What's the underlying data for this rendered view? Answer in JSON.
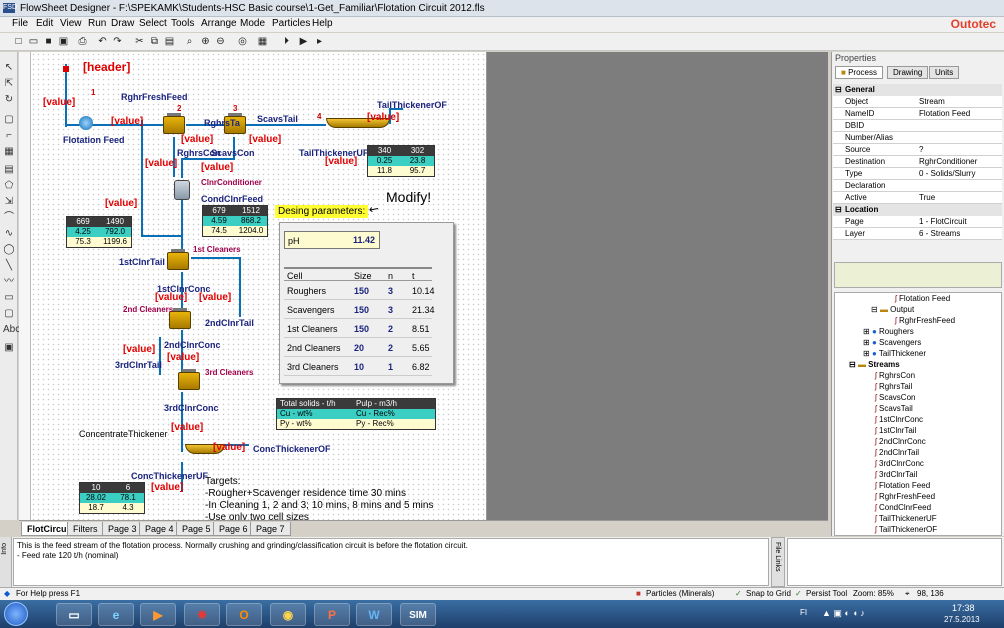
{
  "window": {
    "title": "FlowSheet Designer - F:\\SPEKAMK\\Students-HSC Basic course\\1-Get_Familiar\\Flotation Circuit 2012.fls",
    "brand": "Outotec"
  },
  "menu": [
    "File",
    "Edit",
    "View",
    "Run",
    "Draw",
    "Select",
    "Tools",
    "Arrange",
    "Mode",
    "Particles",
    "Help"
  ],
  "canvas": {
    "header": "[header]",
    "value": "[value]",
    "numbers": [
      "1",
      "2",
      "3",
      "4"
    ],
    "streams": {
      "rghr_fresh_feed": "RghrFreshFeed",
      "flotation_feed": "Flotation Feed",
      "rghrs_ta": "RghrsTa",
      "scavs_tail": "ScavsTail",
      "tail_thickener_of": "TailThickenerOF",
      "rghrs_con": "RghrsCon",
      "scavs_con": "ScavsCon",
      "tail_thickener_uf": "TailThickenerUF",
      "cond_clnr_feed": "CondClnrFeed",
      "first_clnr_tail": "1stClnrTail",
      "first_clnr_conc": "1stClnrConc",
      "second_clnr_tail": "2ndClnrTail",
      "second_clnr_conc": "2ndClnrConc",
      "third_clnr_tail": "3rdClnrTail",
      "third_clnr_conc": "3rdClnrConc",
      "conc_thickener_of": "ConcThickenerOF",
      "conc_thickener_uf": "ConcThickenerUF"
    },
    "processes": {
      "clnr_conditioner": "ClnrConditioner",
      "first_cleaners": "1st Cleaners",
      "second_cleaners": "2nd Cleaners",
      "third_cleaners": "3rd Cleaners",
      "concentrate_thickener": "ConcentrateThickener"
    },
    "tables": {
      "tail": [
        [
          "340",
          "302"
        ],
        [
          "0.25",
          "23.8"
        ],
        [
          "11.8",
          "95.7"
        ]
      ],
      "left": [
        [
          "669",
          "1490"
        ],
        [
          "4.25",
          "792.0"
        ],
        [
          "75.3",
          "1199.6"
        ]
      ],
      "cond": [
        [
          "679",
          "1512"
        ],
        [
          "4.59",
          "868.2"
        ],
        [
          "74.5",
          "1204.0"
        ]
      ],
      "conc": [
        [
          "10",
          "6"
        ],
        [
          "28.02",
          "78.1"
        ],
        [
          "18.7",
          "4.3"
        ]
      ]
    },
    "legend": [
      [
        "Total solids - t/h",
        "Pulp - m3/h"
      ],
      [
        "Cu - wt%",
        "Cu - Rec%"
      ],
      [
        "Py - wt%",
        "Py - Rec%"
      ]
    ],
    "design_label": "Desing parameters:",
    "modify": "Modify!",
    "ph_label": "pH",
    "ph_value": "11.42",
    "cells": {
      "headers": [
        "Cell",
        "Size",
        "n",
        "t"
      ],
      "rows": [
        [
          "Roughers",
          "150",
          "3",
          "10.14"
        ],
        [
          "Scavengers",
          "150",
          "3",
          "21.34"
        ],
        [
          "1st Cleaners",
          "150",
          "2",
          "8.51"
        ],
        [
          "2nd Cleaners",
          "20",
          "2",
          "5.65"
        ],
        [
          "3rd Cleaners",
          "10",
          "1",
          "6.82"
        ]
      ]
    },
    "targets": [
      "Targets:",
      "-Rougher+Scavenger residence time 30 mins",
      "-In Cleaning 1, 2 and 3; 10 mins, 8 mins and 5 mins",
      "-Use only two cell sizes"
    ]
  },
  "tabs": [
    "FlotCircuit",
    "Filters",
    "Page 3",
    "Page 4",
    "Page 5",
    "Page 6",
    "Page 7"
  ],
  "props": {
    "title": "Properties",
    "tabs": [
      "Process",
      "Drawing",
      "Units"
    ],
    "general": "General",
    "location": "Location",
    "rows": [
      [
        "Object",
        "Stream"
      ],
      [
        "NameID",
        "Flotation Feed"
      ],
      [
        "DBID",
        ""
      ],
      [
        "Number/Alias",
        ""
      ],
      [
        "Source",
        "?"
      ],
      [
        "Destination",
        "RghrConditioner"
      ],
      [
        "Type",
        "0 - Solids/Slurry"
      ],
      [
        "Declaration",
        ""
      ],
      [
        "Active",
        "True"
      ]
    ],
    "loc_rows": [
      [
        "Page",
        "1 - FlotCircuit"
      ],
      [
        "Layer",
        "6 - Streams"
      ]
    ]
  },
  "tree": {
    "top": [
      "Flotation Feed",
      "Output",
      "RghrFreshFeed",
      "Roughers",
      "Scavengers",
      "TailThickener"
    ],
    "streams_label": "Streams",
    "streams": [
      "RghrsCon",
      "RghrsTail",
      "ScavsCon",
      "ScavsTail",
      "1stClnrConc",
      "1stClnrTail",
      "2ndClnrConc",
      "2ndClnrTail",
      "3rdClnrConc",
      "3rdClnrTail",
      "Flotation Feed",
      "RghrFreshFeed",
      "CondClnrFeed",
      "TailThickenerUF",
      "TailThickenerOF"
    ]
  },
  "info": {
    "label": "Info",
    "line1": "This is the feed stream of the flotation process. Normally crushing and grinding/classification circuit is before the flotation circuit.",
    "line2": "- Feed rate 120 t/h (nominal)",
    "file_links": "File Links"
  },
  "status": {
    "help": "For Help press F1",
    "particles": "Particles (Minerals)",
    "snap": "Snap to Grid",
    "persist": "Persist Tool",
    "zoom": "Zoom: 85%",
    "coords": "98, 136"
  },
  "taskbar": {
    "lang": "FI",
    "time": "17:38",
    "date": "27.5.2013"
  }
}
